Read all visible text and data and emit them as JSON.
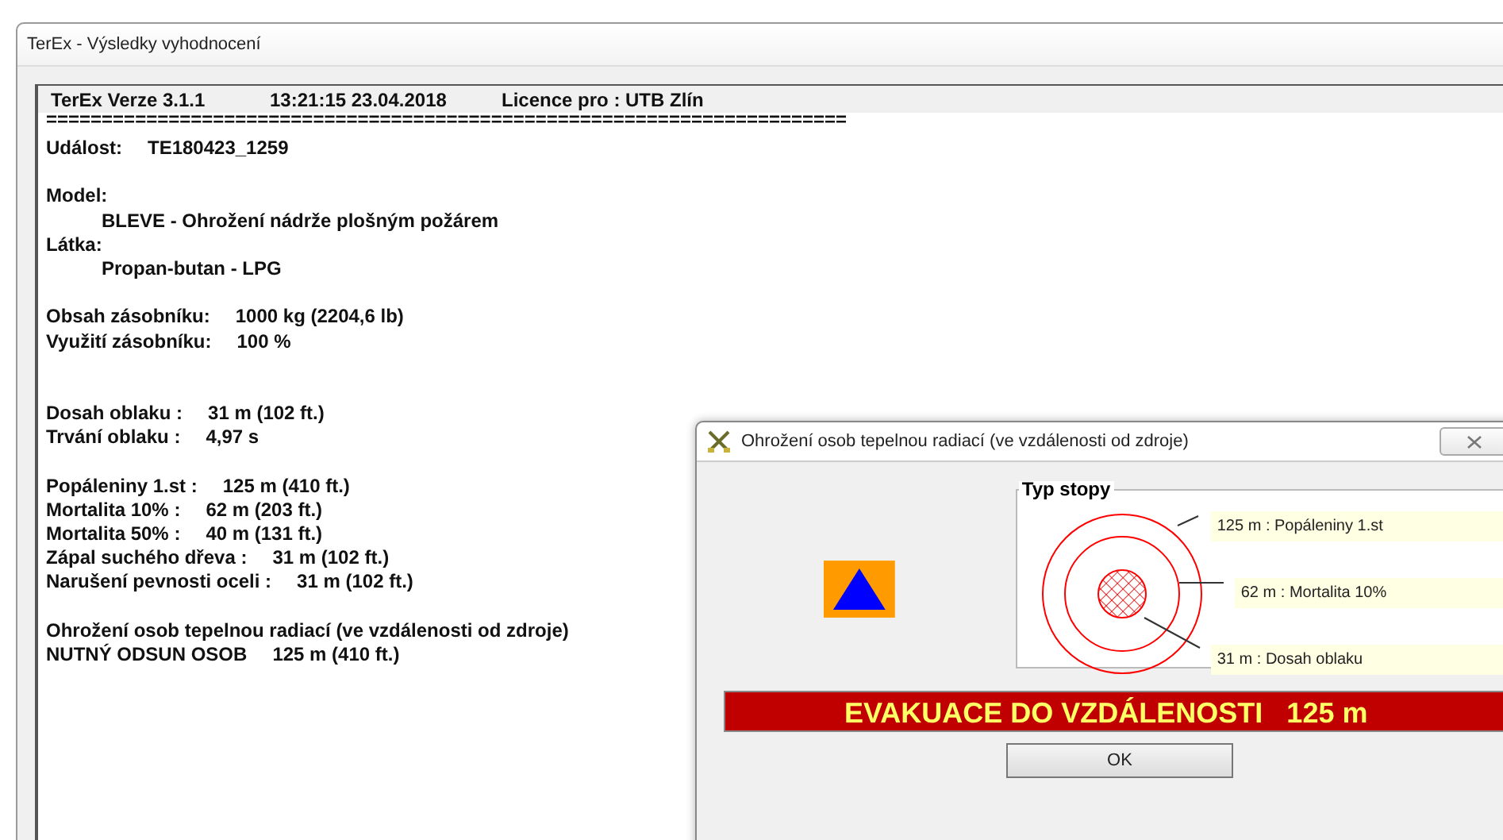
{
  "window": {
    "title": "TerEx - Výsledky vyhodnocení"
  },
  "report": {
    "header": [
      "TerEx  Verze 3.1.1",
      "13:21:15  23.04.2018",
      "Licence pro : UTB Zlín"
    ],
    "separator": "========================================================================",
    "lines": [
      {
        "kind": "field",
        "label": "Událost:",
        "value": "TE180423_1259"
      },
      {
        "kind": "blank"
      },
      {
        "kind": "heading",
        "text": "Model:"
      },
      {
        "kind": "indented",
        "text": "BLEVE - Ohrožení nádrže plošným požárem"
      },
      {
        "kind": "heading",
        "text": "Látka:"
      },
      {
        "kind": "indented",
        "text": "Propan-butan - LPG"
      },
      {
        "kind": "blank"
      },
      {
        "kind": "field",
        "label": "Obsah zásobníku:",
        "value": "1000 kg (2204,6 lb)"
      },
      {
        "kind": "field",
        "label": "Využití zásobníku:",
        "value": "100 %"
      },
      {
        "kind": "blank"
      },
      {
        "kind": "blank"
      },
      {
        "kind": "field",
        "label": "Dosah oblaku :",
        "value": "31 m (102 ft.)"
      },
      {
        "kind": "field",
        "label": "Trvání oblaku :",
        "value": "4,97 s"
      },
      {
        "kind": "blank"
      },
      {
        "kind": "field",
        "label": "Popáleniny 1.st :",
        "value": "125 m (410 ft.)"
      },
      {
        "kind": "field",
        "label": "Mortalita 10% :",
        "value": "62 m (203 ft.)"
      },
      {
        "kind": "field",
        "label": "Mortalita 50% :",
        "value": "40 m (131 ft.)"
      },
      {
        "kind": "field",
        "label": "Zápal suchého dřeva :",
        "value": "31 m (102 ft.)"
      },
      {
        "kind": "field",
        "label": "Narušení pevnosti oceli :",
        "value": "31 m (102 ft.)"
      },
      {
        "kind": "blank"
      },
      {
        "kind": "heading",
        "text": "Ohrožení osob tepelnou radiací (ve vzdálenosti od zdroje)"
      },
      {
        "kind": "field",
        "label": "NUTNÝ ODSUN OSOB",
        "value": "125 m (410 ft.)"
      }
    ]
  },
  "dialog": {
    "title": "Ohrožení osob tepelnou radiací (ve vzdálenosti od zdroje)",
    "group_title": "Typ stopy",
    "zones": [
      {
        "kind": "ring",
        "label": "125 m : Popáleniny 1.st"
      },
      {
        "kind": "ring",
        "label": "62 m : Mortalita 10%"
      },
      {
        "kind": "hatched",
        "label": "31 m : Dosah oblaku"
      }
    ],
    "banner": "EVAKUACE DO VZDÁLENOSTI   125 m",
    "button": "OK"
  }
}
